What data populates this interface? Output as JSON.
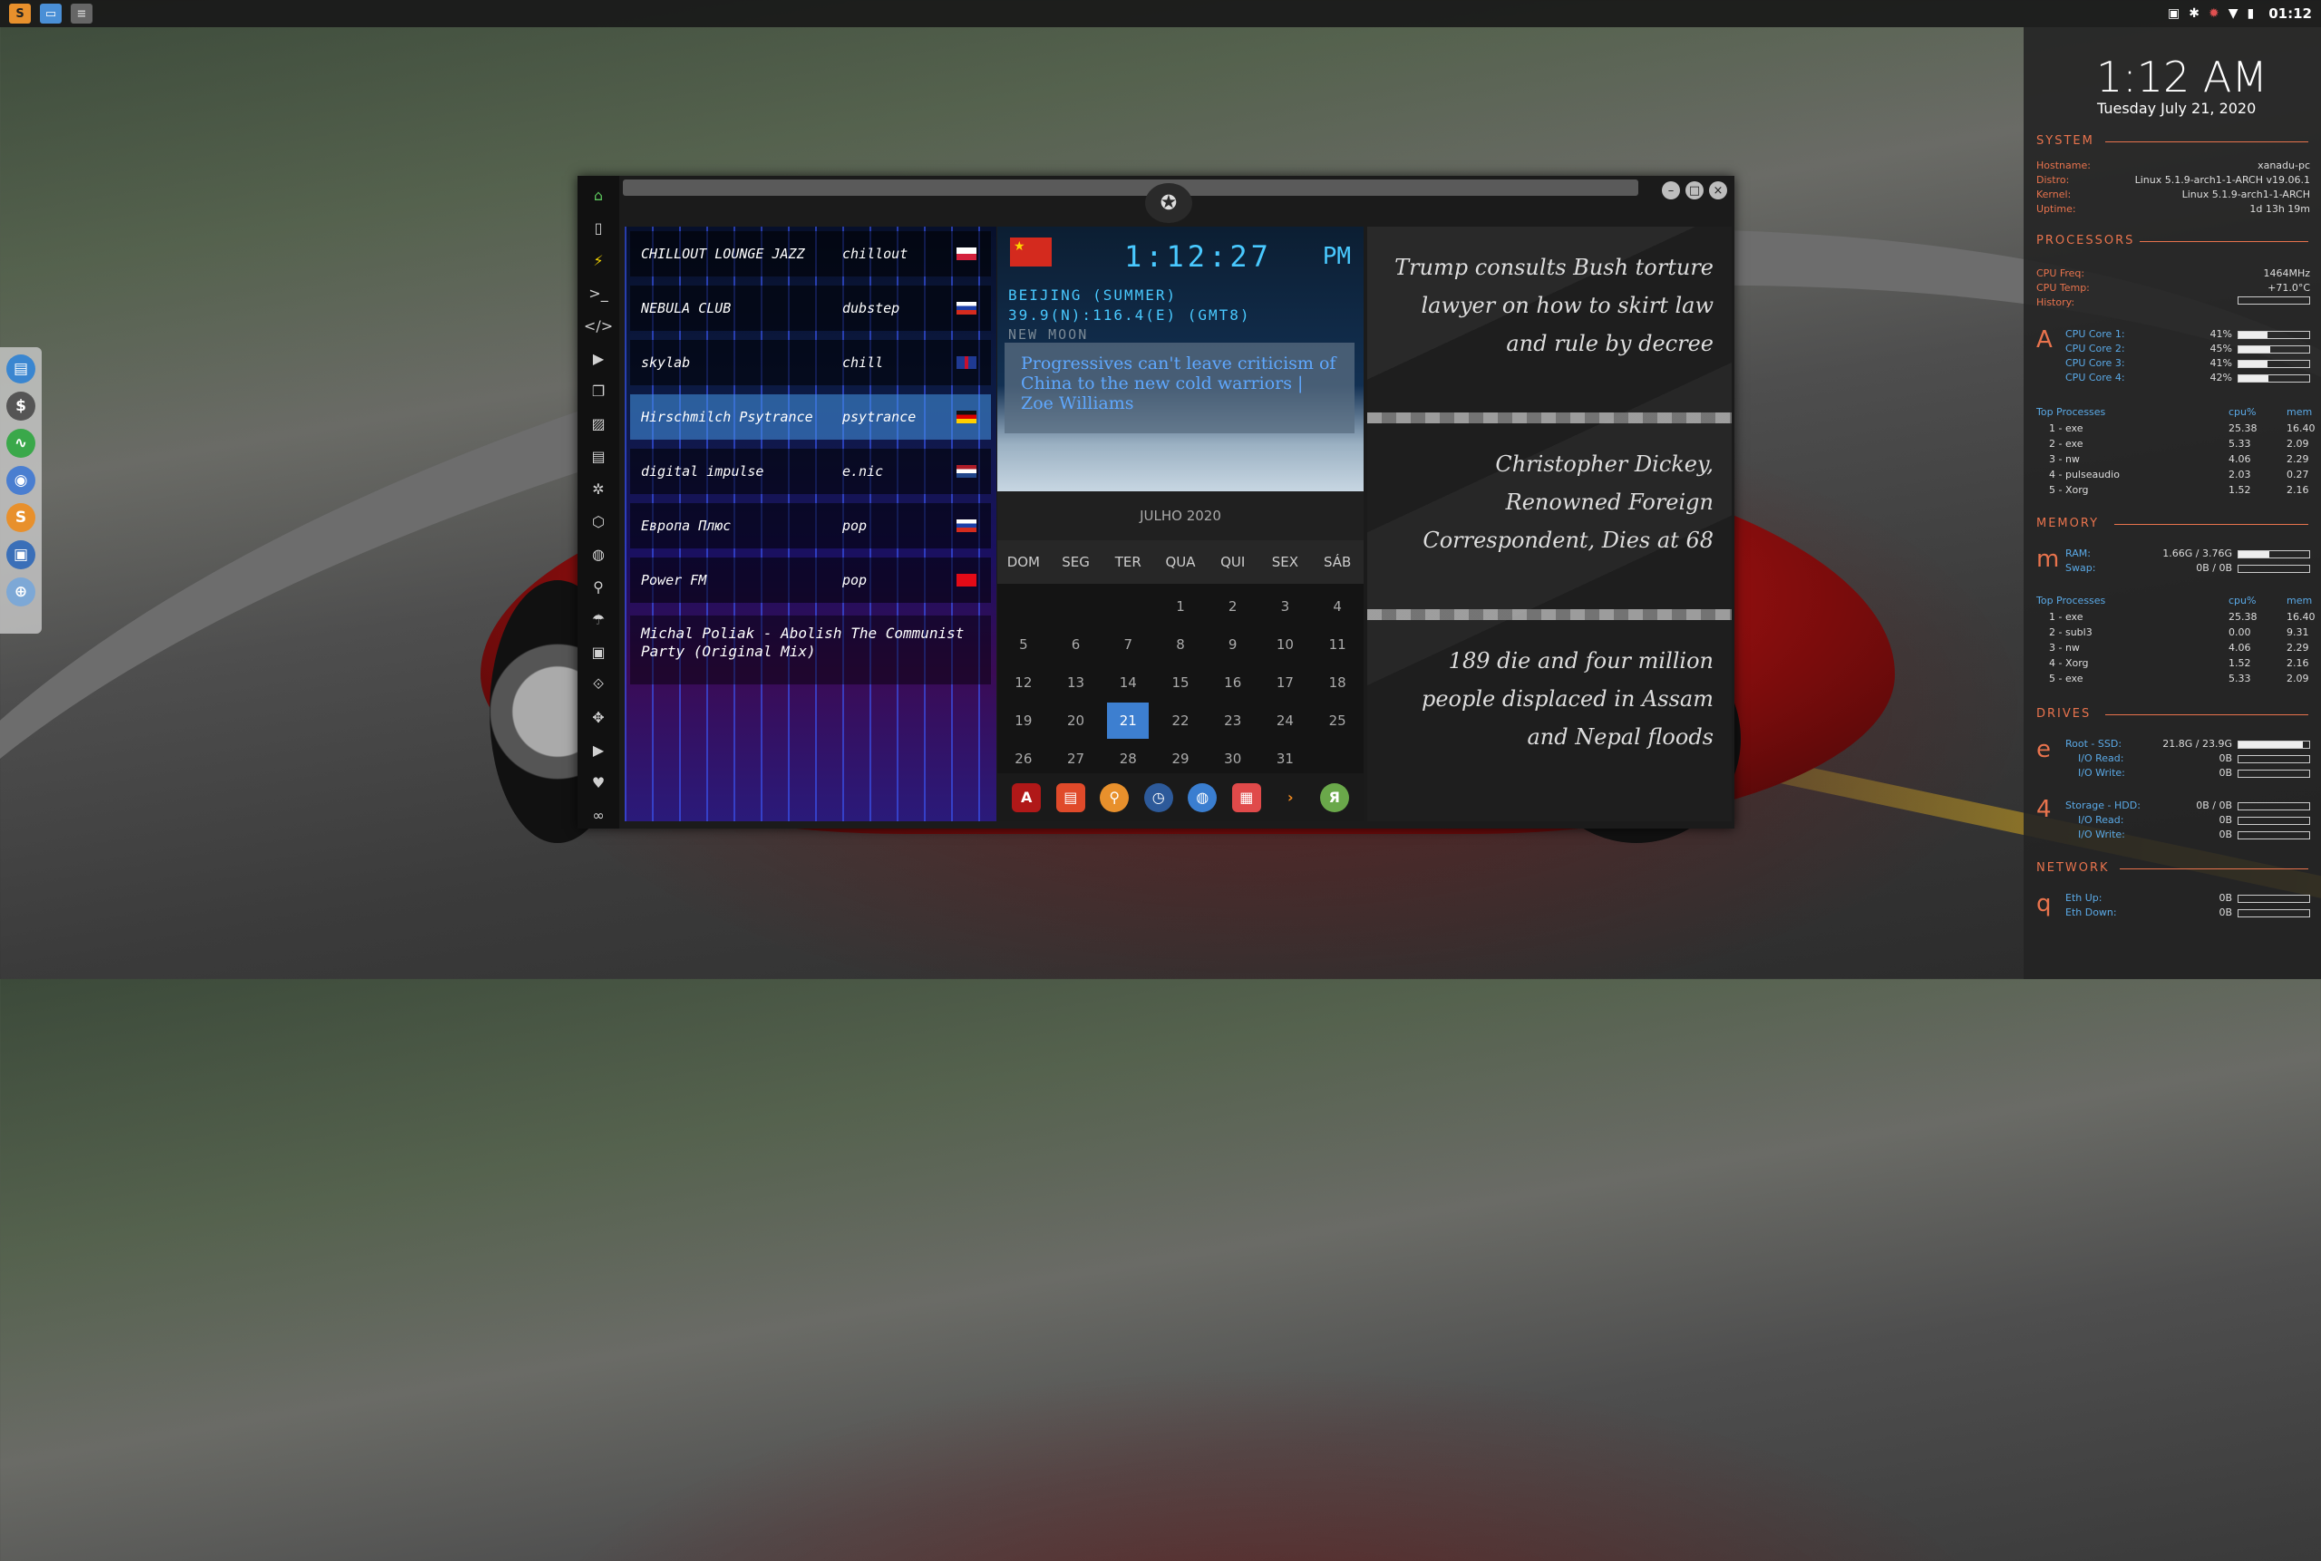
{
  "topbar": {
    "clock": "01:12"
  },
  "window": {
    "radio": {
      "stations": [
        {
          "name": "CHILLOUT LOUNGE JAZZ",
          "genre": "chillout",
          "flag": "pl",
          "active": false
        },
        {
          "name": "NEBULA CLUB",
          "genre": "dubstep",
          "flag": "ru",
          "active": false
        },
        {
          "name": "skylab",
          "genre": "chill",
          "flag": "uk",
          "active": false
        },
        {
          "name": "Hirschmilch Psytrance",
          "genre": "psytrance",
          "flag": "de",
          "active": true
        },
        {
          "name": "digital impulse",
          "genre": "e.nic",
          "flag": "nl",
          "active": false
        },
        {
          "name": "Европа Плюс",
          "genre": "pop",
          "flag": "ru",
          "active": false
        },
        {
          "name": "Power FM",
          "genre": "pop",
          "flag": "tr",
          "active": false
        }
      ],
      "now_playing": "Michal Poliak - Abolish The Communist Party (Original Mix)"
    },
    "world_clock": {
      "time": "1:12:27",
      "ampm": "PM",
      "city": "BEIJING (SUMMER)",
      "coords": "39.9(N):116.4(E) (GMT8)",
      "moon": "NEW MOON"
    },
    "headline": "Progressives can't leave criticism of China to the new cold warriors | Zoe Williams",
    "calendar": {
      "month": "JULHO 2020",
      "days_of_week": [
        "DOM",
        "SEG",
        "TER",
        "QUA",
        "QUI",
        "SEX",
        "SÁB"
      ],
      "weeks": [
        [
          "",
          "",
          "",
          "1",
          "2",
          "3",
          "4"
        ],
        [
          "5",
          "6",
          "7",
          "8",
          "9",
          "10",
          "11"
        ],
        [
          "12",
          "13",
          "14",
          "15",
          "16",
          "17",
          "18"
        ],
        [
          "19",
          "20",
          "21",
          "22",
          "23",
          "24",
          "25"
        ],
        [
          "26",
          "27",
          "28",
          "29",
          "30",
          "31",
          ""
        ]
      ],
      "today": "21"
    },
    "news": [
      "Trump consults Bush torture lawyer on how to skirt law and rule by decree",
      "Christopher Dickey, Renowned Foreign Correspondent, Dies at 68",
      "189 die and four million people displaced in Assam and Nepal floods"
    ]
  },
  "conky": {
    "time": "1:12 AM",
    "date": "Tuesday July 21, 2020",
    "system": {
      "title": "SYSTEM",
      "rows": [
        {
          "label": "Hostname:",
          "value": "xanadu-pc"
        },
        {
          "label": "Distro:",
          "value": "Linux 5.1.9-arch1-1-ARCH v19.06.1"
        },
        {
          "label": "Kernel:",
          "value": "Linux 5.1.9-arch1-1-ARCH"
        },
        {
          "label": "Uptime:",
          "value": "1d 13h 19m"
        }
      ]
    },
    "processors": {
      "title": "PROCESSORS",
      "freq_label": "CPU Freq:",
      "freq": "1464MHz",
      "temp_label": "CPU Temp:",
      "temp": "+71.0°C",
      "history_label": "History:",
      "letter": "A",
      "cores": [
        {
          "label": "CPU Core 1:",
          "value": "41%",
          "pct": 41
        },
        {
          "label": "CPU Core 2:",
          "value": "45%",
          "pct": 45
        },
        {
          "label": "CPU Core 3:",
          "value": "41%",
          "pct": 41
        },
        {
          "label": "CPU Core 4:",
          "value": "42%",
          "pct": 42
        }
      ],
      "top_label": "Top Processes",
      "cpu_label": "cpu%",
      "mem_label": "mem",
      "top": [
        {
          "name": "1 - exe",
          "cpu": "25.38",
          "mem": "16.40"
        },
        {
          "name": "2 - exe",
          "cpu": "5.33",
          "mem": "2.09"
        },
        {
          "name": "3 - nw",
          "cpu": "4.06",
          "mem": "2.29"
        },
        {
          "name": "4 - pulseaudio",
          "cpu": "2.03",
          "mem": "0.27"
        },
        {
          "name": "5 - Xorg",
          "cpu": "1.52",
          "mem": "2.16"
        }
      ]
    },
    "memory": {
      "title": "MEMORY",
      "letter": "m",
      "ram_label": "RAM:",
      "ram": "1.66G / 3.76G",
      "ram_pct": 44,
      "swap_label": "Swap:",
      "swap": "0B / 0B",
      "swap_pct": 0,
      "top_label": "Top Processes",
      "cpu_label": "cpu%",
      "mem_label": "mem",
      "top": [
        {
          "name": "1 - exe",
          "cpu": "25.38",
          "mem": "16.40"
        },
        {
          "name": "2 - subl3",
          "cpu": "0.00",
          "mem": "9.31"
        },
        {
          "name": "3 - nw",
          "cpu": "4.06",
          "mem": "2.29"
        },
        {
          "name": "4 - Xorg",
          "cpu": "1.52",
          "mem": "2.16"
        },
        {
          "name": "5 - exe",
          "cpu": "5.33",
          "mem": "2.09"
        }
      ]
    },
    "drives": {
      "title": "DRIVES",
      "root_letter": "e",
      "root_label": "Root - SSD:",
      "root": "21.8G / 23.9G",
      "root_pct": 91,
      "io_read_label": "I/O Read:",
      "io_read": "0B",
      "io_write_label": "I/O Write:",
      "io_write": "0B",
      "storage_letter": "4",
      "storage_label": "Storage - HDD:",
      "storage": "0B / 0B",
      "storage_pct": 0,
      "s_io_read": "0B",
      "s_io_write": "0B"
    },
    "network": {
      "title": "NETWORK",
      "letter": "q",
      "up_label": "Eth Up:",
      "up": "0B",
      "down_label": "Eth Down:",
      "down": "0B"
    }
  }
}
